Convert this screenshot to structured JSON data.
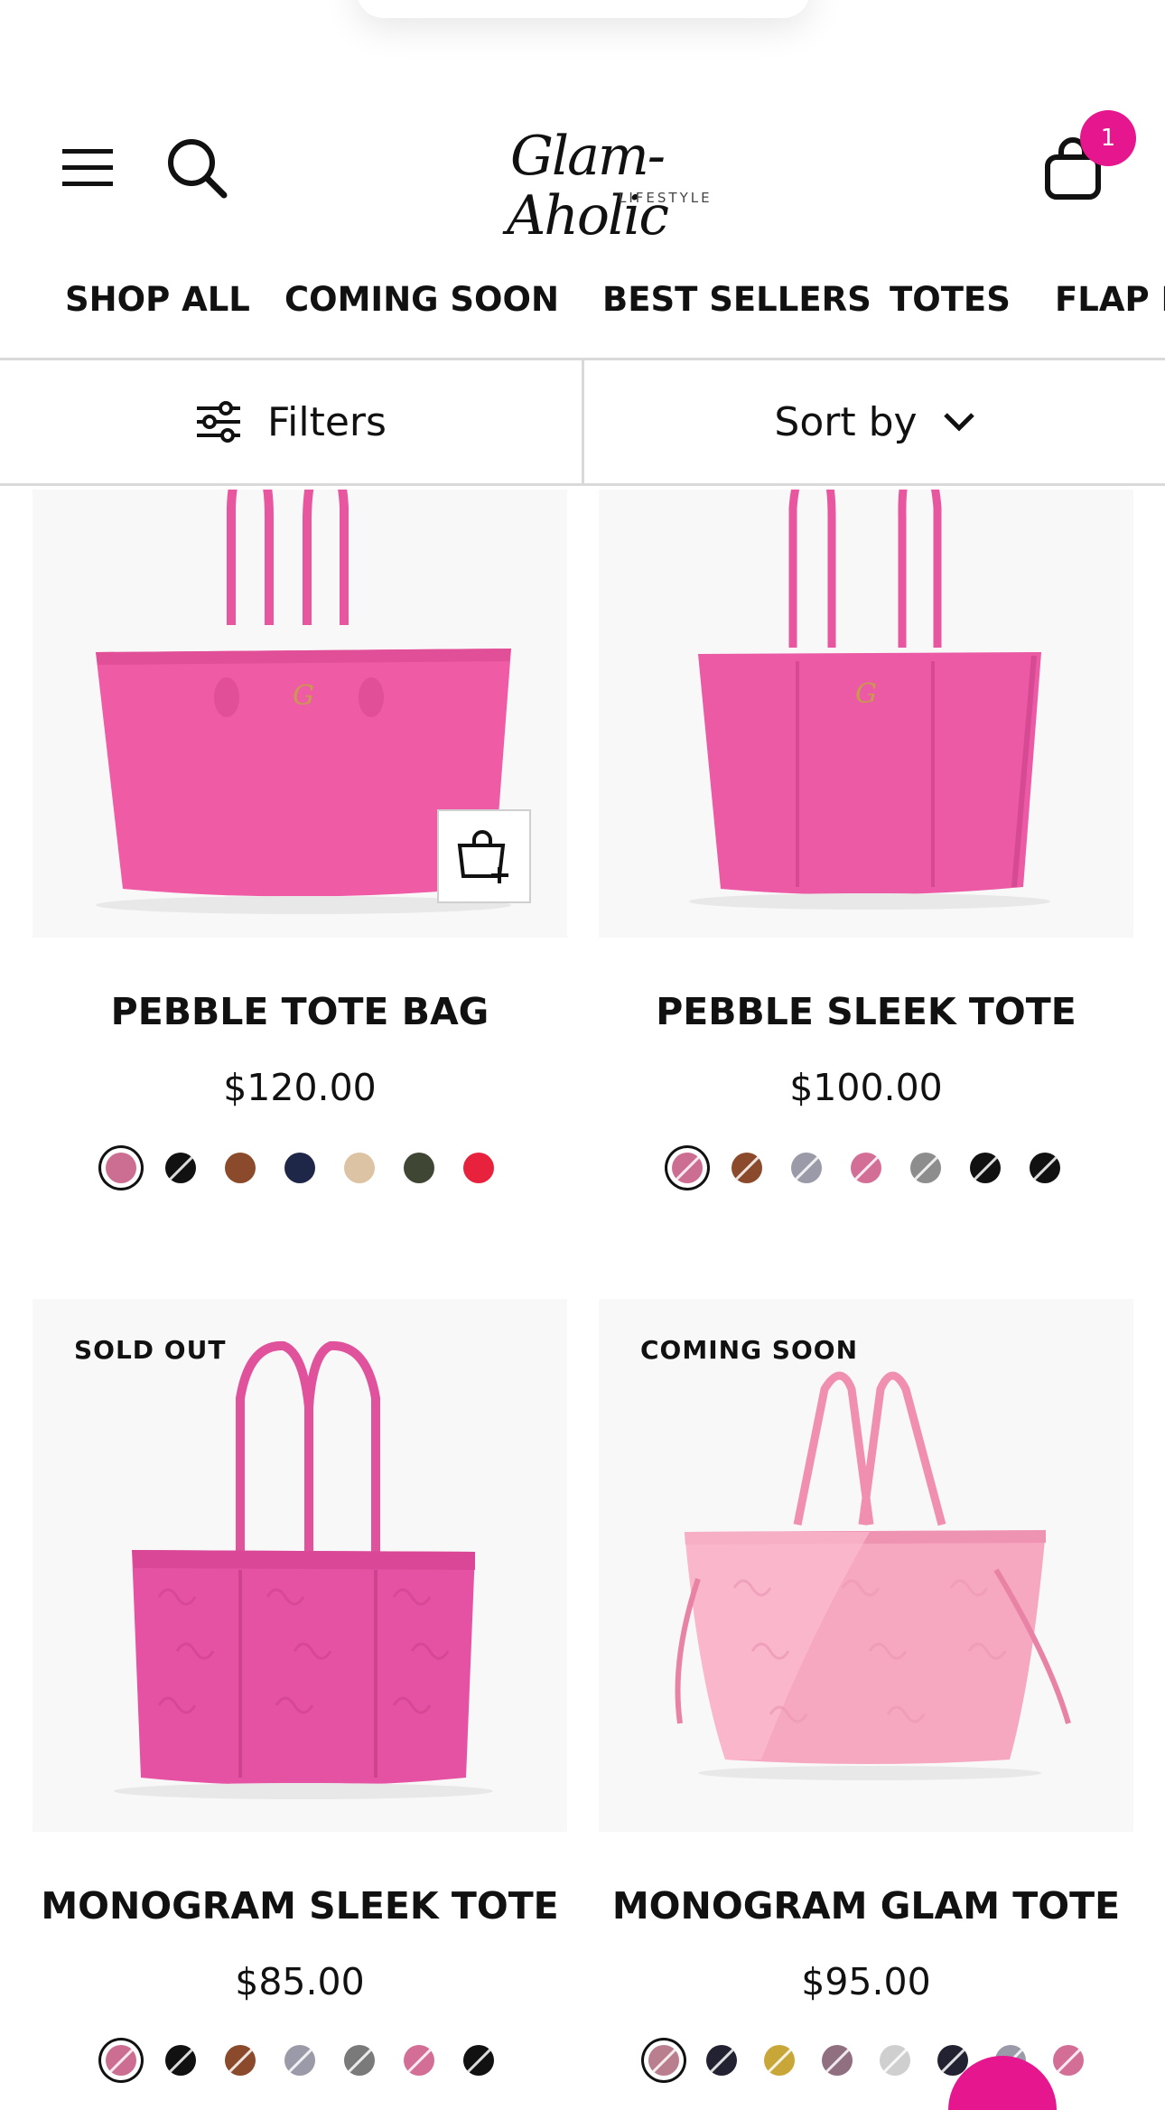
{
  "header": {
    "logo_text": "Glam-Aholic",
    "logo_subtext": "LIFESTYLE",
    "cart_count": "1",
    "brand_color": "#e6168f"
  },
  "categories": [
    "SHOP ALL",
    "COMING SOON",
    "BEST SELLERS",
    "TOTES",
    "FLAP B"
  ],
  "toolbar": {
    "filters_label": "Filters",
    "sort_label": "Sort by"
  },
  "products": [
    {
      "title": "PEBBLE TOTE BAG",
      "price": "$120.00",
      "badge": "",
      "swatches": [
        "#cc6d92",
        "#111111",
        "#8a4a2b",
        "#1f2748",
        "#dcc3a3",
        "#3f4633",
        "#e8213d"
      ]
    },
    {
      "title": "PEBBLE SLEEK TOTE",
      "price": "$100.00",
      "badge": "",
      "swatches": [
        "#cc6d92",
        "#8a4a2b",
        "#9a9aa8",
        "#d36f97",
        "#8d8d8d",
        "#111111",
        "#111111"
      ]
    },
    {
      "title": "MONOGRAM SLEEK TOTE",
      "price": "$85.00",
      "badge": "SOLD OUT",
      "swatches": [
        "#cc6d92",
        "#111111",
        "#8a4a2b",
        "#9a9aa8",
        "#7a7a7a",
        "#d36f97",
        "#111111"
      ]
    },
    {
      "title": "MONOGRAM GLAM TOTE",
      "price": "$95.00",
      "badge": "COMING SOON",
      "swatches": [
        "#b97f8e",
        "#222233",
        "#c8a638",
        "#8f6f80",
        "#cfcfcf",
        "#222233",
        "#9a9aa8",
        "#d36f97"
      ]
    }
  ]
}
